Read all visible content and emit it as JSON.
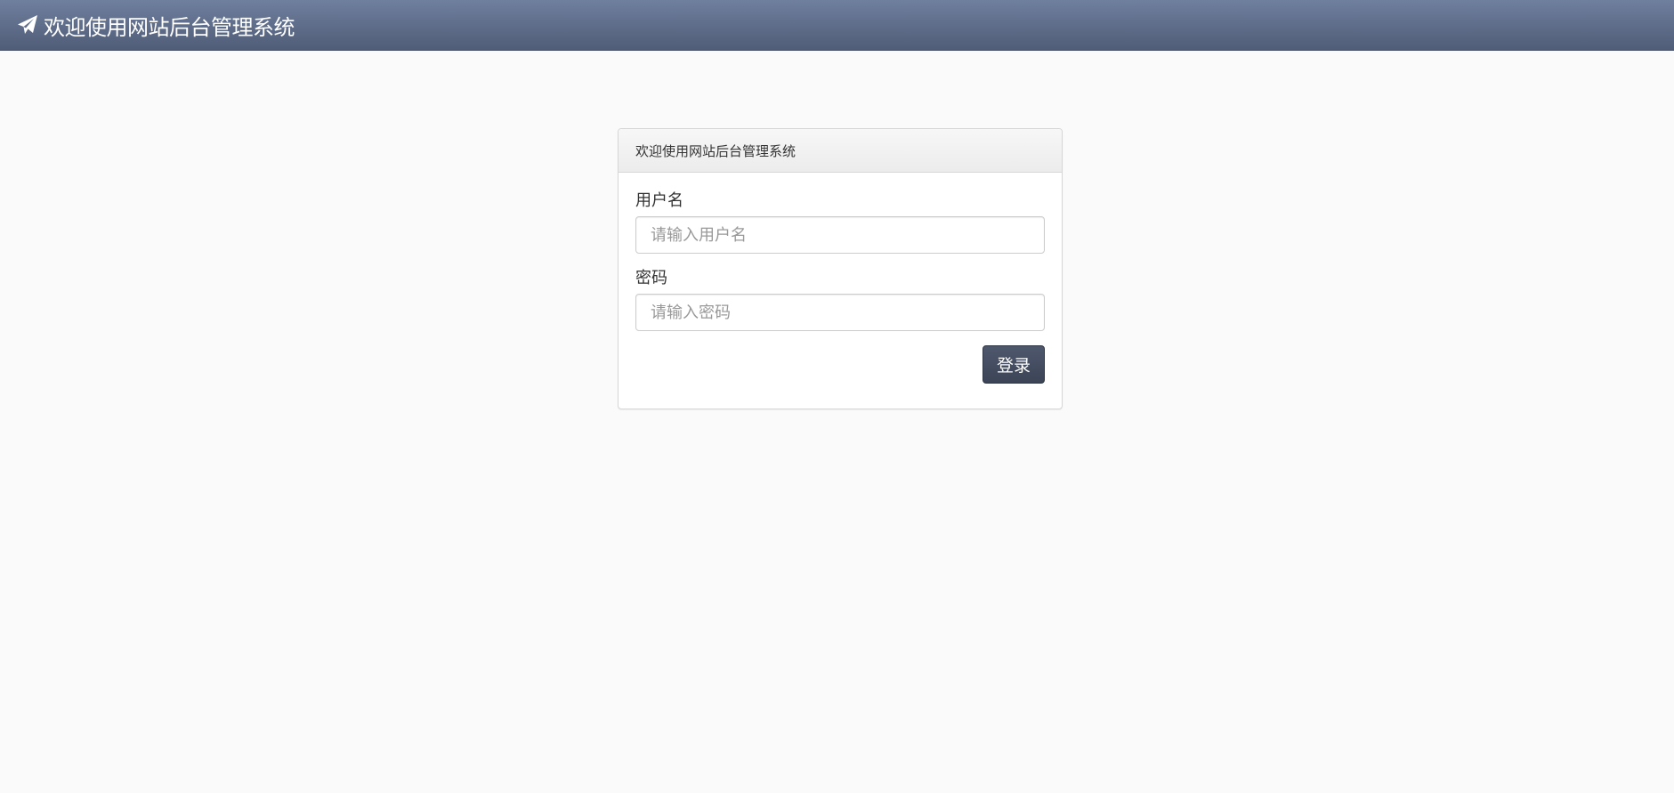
{
  "navbar": {
    "brand_icon": "paper-plane-icon",
    "brand_title": "欢迎使用网站后台管理系统",
    "colors": {
      "bar_top": "#6f7f9e",
      "bar_bottom": "#505d78"
    }
  },
  "login_panel": {
    "heading": "欢迎使用网站后台管理系统",
    "username": {
      "label": "用户名",
      "value": "",
      "placeholder": "请输入用户名"
    },
    "password": {
      "label": "密码",
      "value": "",
      "placeholder": "请输入密码"
    },
    "submit_label": "登录",
    "colors": {
      "button": "#465064"
    }
  }
}
